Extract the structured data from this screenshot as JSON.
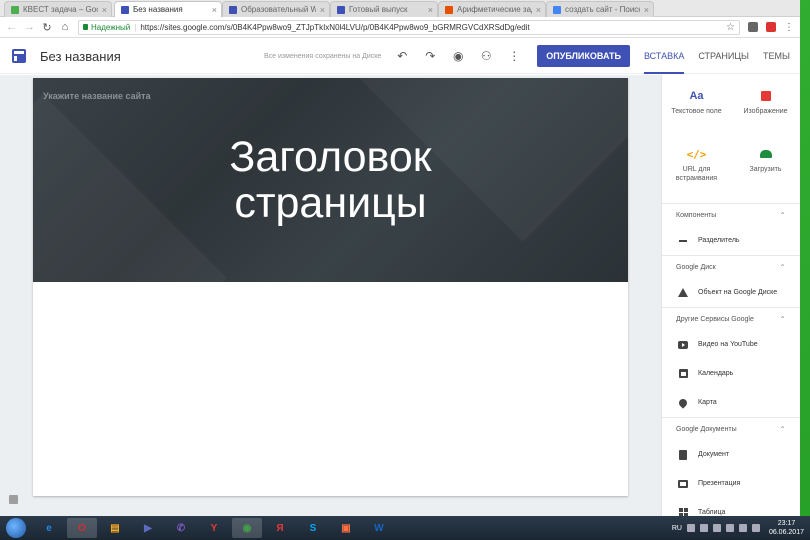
{
  "browser": {
    "tabs": [
      {
        "label": "КВЕСТ задача – Google",
        "color": "#4caf50",
        "active": false
      },
      {
        "label": "Без названия",
        "color": "#3f51b5",
        "active": true
      },
      {
        "label": "Образовательный WEI",
        "color": "#3f51b5",
        "active": false
      },
      {
        "label": "Готовый выпуск",
        "color": "#3f51b5",
        "active": false
      },
      {
        "label": "Арифметические зада",
        "color": "#e65100",
        "active": false
      },
      {
        "label": "создать сайт - Поиск в",
        "color": "#4285f4",
        "active": false
      }
    ],
    "close_glyph": "×",
    "secure_label": "Надежный",
    "url": "https://sites.google.com/s/0B4K4Ppw8wo9_ZTJpTkIxN0l4LVU/p/0B4K4Ppw8wo9_bGRMRGVCdXRSdDg/edit"
  },
  "app": {
    "title": "Без названия",
    "saved_status": "Все изменения сохранены на Диске",
    "publish_label": "ОПУБЛИКОВАТЬ",
    "sidebar_tabs": [
      "ВСТАВКА",
      "СТРАНИЦЫ",
      "ТЕМЫ"
    ]
  },
  "canvas": {
    "site_name_placeholder": "Укажите название сайта",
    "page_heading_line1": "Заголовок",
    "page_heading_line2": "страницы"
  },
  "sidebar": {
    "insert": {
      "text_box": {
        "icon_text": "Aa",
        "label": "Текстовое поле"
      },
      "image": {
        "label": "Изображение"
      },
      "embed": {
        "icon_text": "</>",
        "label_line1": "URL для",
        "label_line2": "встраивания"
      },
      "upload": {
        "label": "Загрузить"
      }
    },
    "sections": {
      "components": {
        "title": "Компоненты",
        "items": [
          "Разделитель"
        ]
      },
      "drive": {
        "title": "Google Диск",
        "items": [
          "Объект на Google Диске"
        ]
      },
      "other": {
        "title": "Другие Сервисы Google",
        "items": [
          "Видео на YouTube",
          "Календарь",
          "Карта"
        ]
      },
      "docs": {
        "title": "Google Документы",
        "items": [
          "Документ",
          "Презентация",
          "Таблица"
        ]
      }
    }
  },
  "taskbar": {
    "apps": [
      {
        "glyph": "e",
        "color": "#1e88e5"
      },
      {
        "glyph": "O",
        "color": "#d32f2f"
      },
      {
        "glyph": "▤",
        "color": "#f9a825"
      },
      {
        "glyph": "▶",
        "color": "#5c6bc0"
      },
      {
        "glyph": "✆",
        "color": "#7e57c2"
      },
      {
        "glyph": "Y",
        "color": "#e53935"
      },
      {
        "glyph": "◉",
        "color": "#43a047"
      },
      {
        "glyph": "Я",
        "color": "#e53935"
      },
      {
        "glyph": "S",
        "color": "#03a9f4"
      },
      {
        "glyph": "▣",
        "color": "#ff7043"
      },
      {
        "glyph": "W",
        "color": "#1565c0"
      }
    ],
    "lang": "RU",
    "time": "23:17",
    "date": "06.06.2017"
  }
}
